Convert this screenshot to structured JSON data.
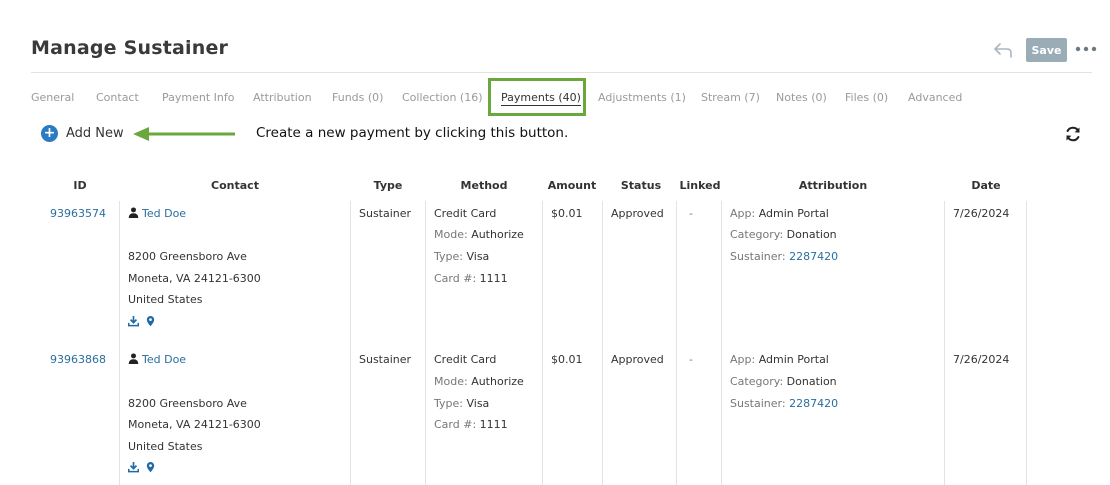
{
  "page": {
    "title": "Manage Sustainer"
  },
  "toolbar": {
    "save_label": "Save"
  },
  "tabs": [
    "General",
    "Contact",
    "Payment Info",
    "Attribution",
    "Funds (0)",
    "Collection (16)",
    "Payments (40)",
    "Adjustments (1)",
    "Stream (7)",
    "Notes (0)",
    "Files (0)",
    "Advanced"
  ],
  "active_tab": "Payments (40)",
  "actions": {
    "add_new_label": "Add New"
  },
  "callout": {
    "text": "Create a new payment by clicking this button."
  },
  "colors": {
    "accent": "#2a7bbf",
    "highlight": "#6aa83d",
    "link": "#2a6f9e",
    "save_bg": "#9aacb6"
  },
  "table": {
    "headers": [
      "ID",
      "Contact",
      "Type",
      "Method",
      "Amount",
      "Status",
      "Linked",
      "Attribution",
      "Date"
    ],
    "rows": [
      {
        "id": "93963574",
        "contact_name": "Ted Doe",
        "address1": "8200 Greensboro Ave",
        "address2": "Moneta, VA 24121-6300",
        "country": "United States",
        "type": "Sustainer",
        "method": "Credit Card",
        "mode_label": "Mode:",
        "mode": "Authorize",
        "cardtype_label": "Type:",
        "cardtype": "Visa",
        "cardnum_label": "Card #:",
        "cardnum": "1111",
        "amount": "$0.01",
        "status": "Approved",
        "linked": "-",
        "app_label": "App:",
        "app": "Admin Portal",
        "category_label": "Category:",
        "category": "Donation",
        "sustainer_label": "Sustainer:",
        "sustainer": "2287420",
        "date": "7/26/2024"
      },
      {
        "id": "93963868",
        "contact_name": "Ted Doe",
        "address1": "8200 Greensboro Ave",
        "address2": "Moneta, VA 24121-6300",
        "country": "United States",
        "type": "Sustainer",
        "method": "Credit Card",
        "mode_label": "Mode:",
        "mode": "Authorize",
        "cardtype_label": "Type:",
        "cardtype": "Visa",
        "cardnum_label": "Card #:",
        "cardnum": "1111",
        "amount": "$0.01",
        "status": "Approved",
        "linked": "-",
        "app_label": "App:",
        "app": "Admin Portal",
        "category_label": "Category:",
        "category": "Donation",
        "sustainer_label": "Sustainer:",
        "sustainer": "2287420",
        "date": "7/26/2024"
      }
    ]
  }
}
